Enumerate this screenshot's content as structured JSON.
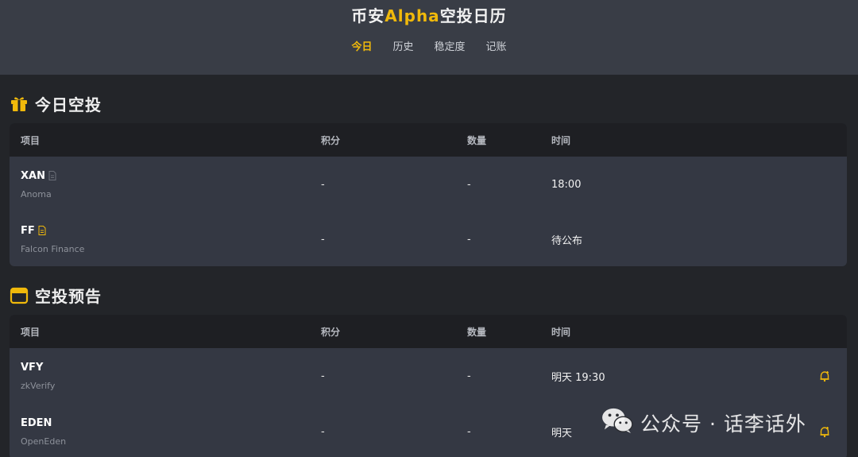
{
  "header": {
    "title_prefix": "币安",
    "title_accent": "Alpha",
    "title_suffix": "空投日历",
    "tabs": [
      "今日",
      "历史",
      "稳定度",
      "记账"
    ]
  },
  "colors": {
    "accent": "#f0b90b",
    "background": "#232529",
    "header": "#393d46",
    "row": "#343843"
  },
  "today": {
    "title": "今日空投",
    "icon": "gift-icon",
    "columns": [
      "项目",
      "积分",
      "数量",
      "时间"
    ],
    "rows": [
      {
        "symbol": "XAN",
        "name": "Anoma",
        "points": "-",
        "amount": "-",
        "time": "18:00"
      },
      {
        "symbol": "FF",
        "name": "Falcon Finance",
        "points": "-",
        "amount": "-",
        "time": "待公布"
      }
    ]
  },
  "upcoming": {
    "title": "空投预告",
    "icon": "calendar-icon",
    "columns": [
      "项目",
      "积分",
      "数量",
      "时间"
    ],
    "rows": [
      {
        "symbol": "VFY",
        "name": "zkVerify",
        "points": "-",
        "amount": "-",
        "time": "明天 19:30"
      },
      {
        "symbol": "EDEN",
        "name": "OpenEden",
        "points": "-",
        "amount": "-",
        "time": "明天"
      }
    ]
  },
  "watermark": {
    "text": "公众号 · 话李话外",
    "icon": "wechat-icon"
  }
}
